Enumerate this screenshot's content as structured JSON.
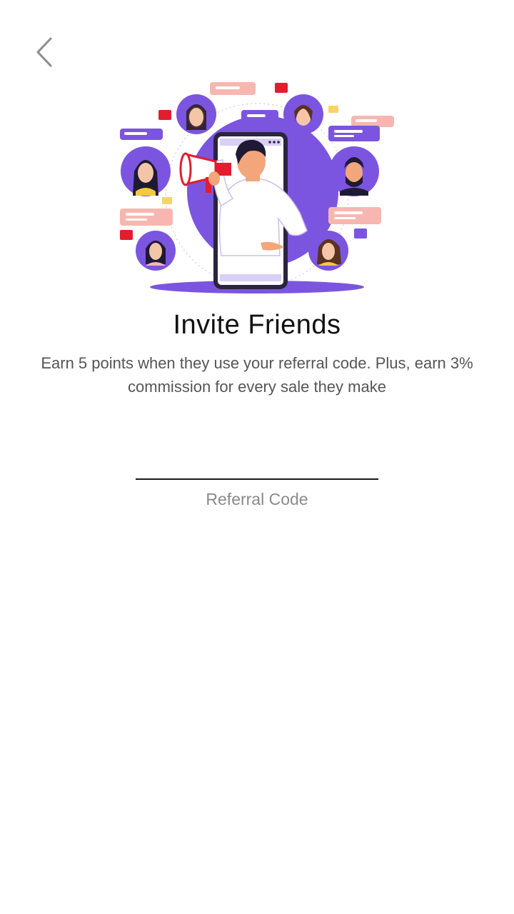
{
  "header": {
    "back_icon": "chevron-left-icon"
  },
  "illustration": {
    "accent_color": "#7B55E0",
    "bubble_color": "#F7B7B0",
    "alert_color": "#E11D2E"
  },
  "invite": {
    "title": "Invite Friends",
    "description": "Earn 5 points when they use your referral code. Plus, earn 3% commission for every sale they make"
  },
  "referral": {
    "value": "",
    "label": "Referral Code"
  }
}
